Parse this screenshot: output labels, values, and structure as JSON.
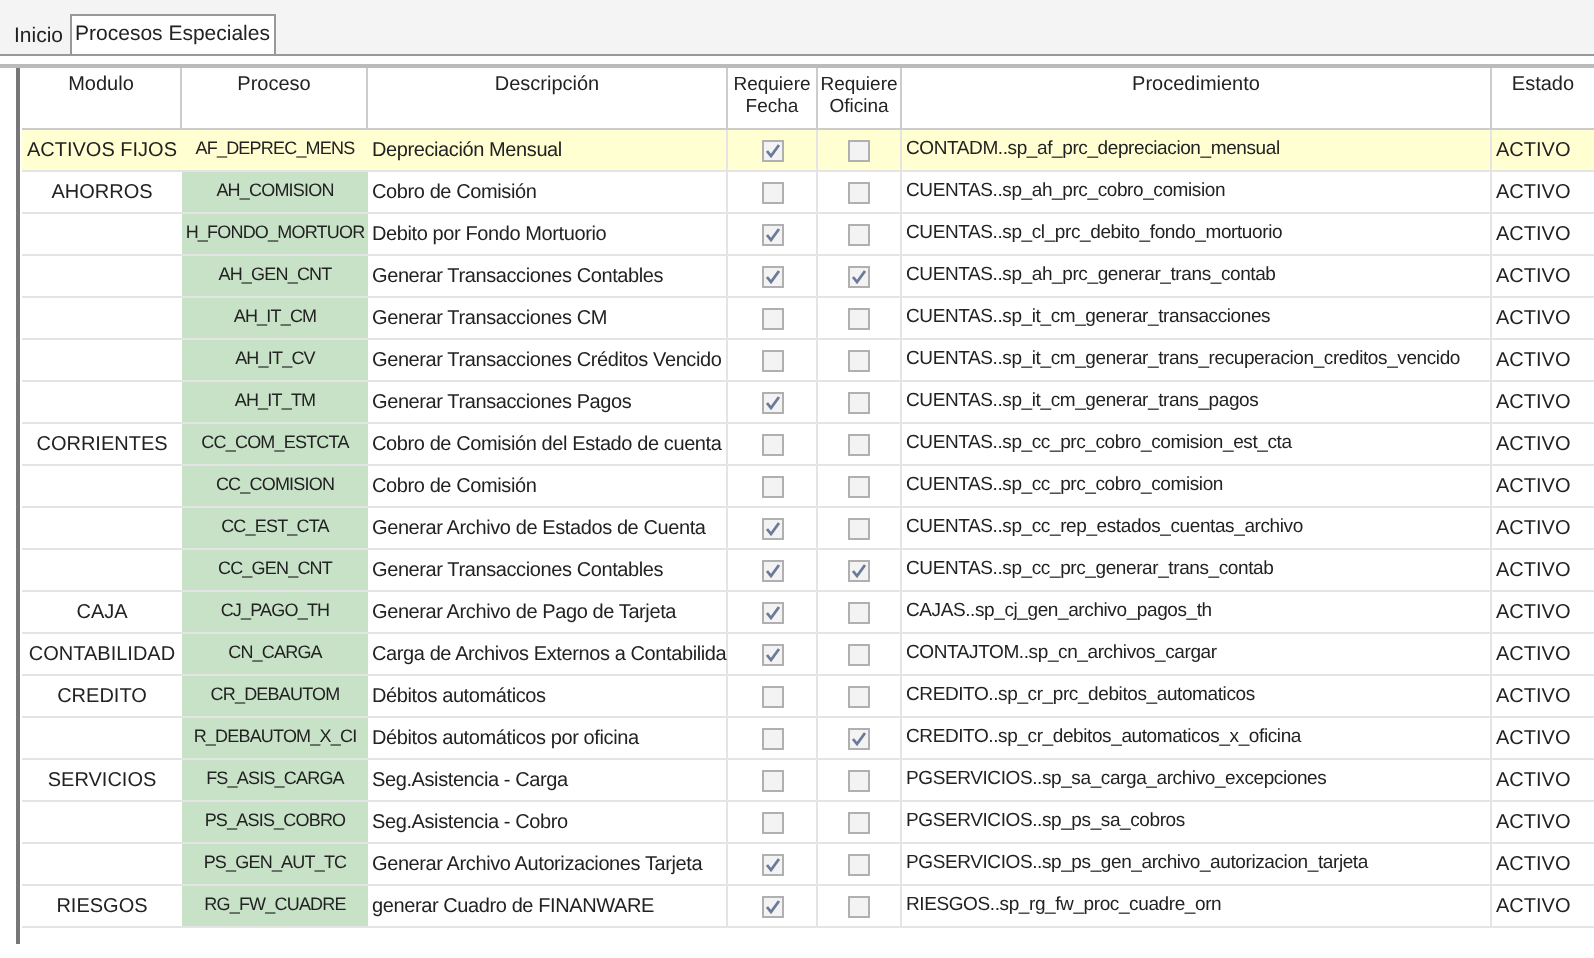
{
  "tabs": [
    {
      "label": "Inicio",
      "selected": false
    },
    {
      "label": "Procesos Especiales",
      "selected": true
    }
  ],
  "table": {
    "columns": [
      "Modulo",
      "Proceso",
      "Descripción",
      "Requiere Fecha",
      "Requiere Oficina",
      "Procedimiento",
      "Estado"
    ],
    "rows": [
      {
        "module": "ACTIVOS FIJOS",
        "process": "AF_DEPREC_MENS",
        "description": "Depreciación Mensual",
        "requires_date": true,
        "requires_office": false,
        "procedure": "CONTADM..sp_af_prc_depreciacion_mensual",
        "status": "ACTIVO",
        "selected": true
      },
      {
        "module": "AHORROS",
        "process": "AH_COMISION",
        "description": "Cobro de Comisión",
        "requires_date": false,
        "requires_office": false,
        "procedure": "CUENTAS..sp_ah_prc_cobro_comision",
        "status": "ACTIVO",
        "selected": false
      },
      {
        "process": "H_FONDO_MORTUOR",
        "description": "Debito por Fondo Mortuorio",
        "requires_date": true,
        "requires_office": false,
        "procedure": "CUENTAS..sp_cl_prc_debito_fondo_mortuorio",
        "status": "ACTIVO",
        "selected": false
      },
      {
        "process": "AH_GEN_CNT",
        "description": "Generar Transacciones Contables",
        "requires_date": true,
        "requires_office": true,
        "procedure": "CUENTAS..sp_ah_prc_generar_trans_contab",
        "status": "ACTIVO",
        "selected": false
      },
      {
        "process": "AH_IT_CM",
        "description": "Generar Transacciones CM",
        "requires_date": false,
        "requires_office": false,
        "procedure": "CUENTAS..sp_it_cm_generar_transacciones",
        "status": "ACTIVO",
        "selected": false
      },
      {
        "process": "AH_IT_CV",
        "description": "Generar Transacciones Créditos Vencido",
        "requires_date": false,
        "requires_office": false,
        "procedure": "CUENTAS..sp_it_cm_generar_trans_recuperacion_creditos_vencido",
        "status": "ACTIVO",
        "selected": false
      },
      {
        "process": "AH_IT_TM",
        "description": "Generar Transacciones Pagos",
        "requires_date": true,
        "requires_office": false,
        "procedure": "CUENTAS..sp_it_cm_generar_trans_pagos",
        "status": "ACTIVO",
        "selected": false
      },
      {
        "module": "CORRIENTES",
        "process": "CC_COM_ESTCTA",
        "description": "Cobro de Comisión del Estado de cuenta",
        "requires_date": false,
        "requires_office": false,
        "procedure": "CUENTAS..sp_cc_prc_cobro_comision_est_cta",
        "status": "ACTIVO",
        "selected": false
      },
      {
        "process": "CC_COMISION",
        "description": "Cobro de Comisión",
        "requires_date": false,
        "requires_office": false,
        "procedure": "CUENTAS..sp_cc_prc_cobro_comision",
        "status": "ACTIVO",
        "selected": false
      },
      {
        "process": "CC_EST_CTA",
        "description": "Generar Archivo de Estados de Cuenta",
        "requires_date": true,
        "requires_office": false,
        "procedure": "CUENTAS..sp_cc_rep_estados_cuentas_archivo",
        "status": "ACTIVO",
        "selected": false
      },
      {
        "process": "CC_GEN_CNT",
        "description": "Generar Transacciones Contables",
        "requires_date": true,
        "requires_office": true,
        "procedure": "CUENTAS..sp_cc_prc_generar_trans_contab",
        "status": "ACTIVO",
        "selected": false
      },
      {
        "module": "CAJA",
        "process": "CJ_PAGO_TH",
        "description": "Generar Archivo de Pago de Tarjeta",
        "requires_date": true,
        "requires_office": false,
        "procedure": "CAJAS..sp_cj_gen_archivo_pagos_th",
        "status": "ACTIVO",
        "selected": false
      },
      {
        "module": "CONTABILIDAD",
        "process": "CN_CARGA",
        "description": "Carga de Archivos Externos a Contabilida",
        "requires_date": true,
        "requires_office": false,
        "procedure": "CONTAJTOM..sp_cn_archivos_cargar",
        "status": "ACTIVO",
        "selected": false
      },
      {
        "module": "CREDITO",
        "process": "CR_DEBAUTOM",
        "description": "Débitos automáticos",
        "requires_date": false,
        "requires_office": false,
        "procedure": "CREDITO..sp_cr_prc_debitos_automaticos",
        "status": "ACTIVO",
        "selected": false
      },
      {
        "process": "R_DEBAUTOM_X_CI",
        "description": "Débitos automáticos por oficina",
        "requires_date": false,
        "requires_office": true,
        "procedure": "CREDITO..sp_cr_debitos_automaticos_x_oficina",
        "status": "ACTIVO",
        "selected": false
      },
      {
        "module": "SERVICIOS",
        "process": "FS_ASIS_CARGA",
        "description": "Seg.Asistencia - Carga",
        "requires_date": false,
        "requires_office": false,
        "procedure": "PGSERVICIOS..sp_sa_carga_archivo_excepciones",
        "status": "ACTIVO",
        "selected": false
      },
      {
        "process": "PS_ASIS_COBRO",
        "description": "Seg.Asistencia - Cobro",
        "requires_date": false,
        "requires_office": false,
        "procedure": "PGSERVICIOS..sp_ps_sa_cobros",
        "status": "ACTIVO",
        "selected": false
      },
      {
        "process": "PS_GEN_AUT_TC",
        "description": "Generar Archivo Autorizaciones Tarjeta",
        "requires_date": true,
        "requires_office": false,
        "procedure": "PGSERVICIOS..sp_ps_gen_archivo_autorizacion_tarjeta",
        "status": "ACTIVO",
        "selected": false
      },
      {
        "module": "RIESGOS",
        "process": "RG_FW_CUADRE",
        "description": "generar Cuadro de FINANWARE",
        "requires_date": true,
        "requires_office": false,
        "procedure": "RIESGOS..sp_rg_fw_proc_cuadre_orn",
        "status": "ACTIVO",
        "selected": false
      }
    ]
  }
}
